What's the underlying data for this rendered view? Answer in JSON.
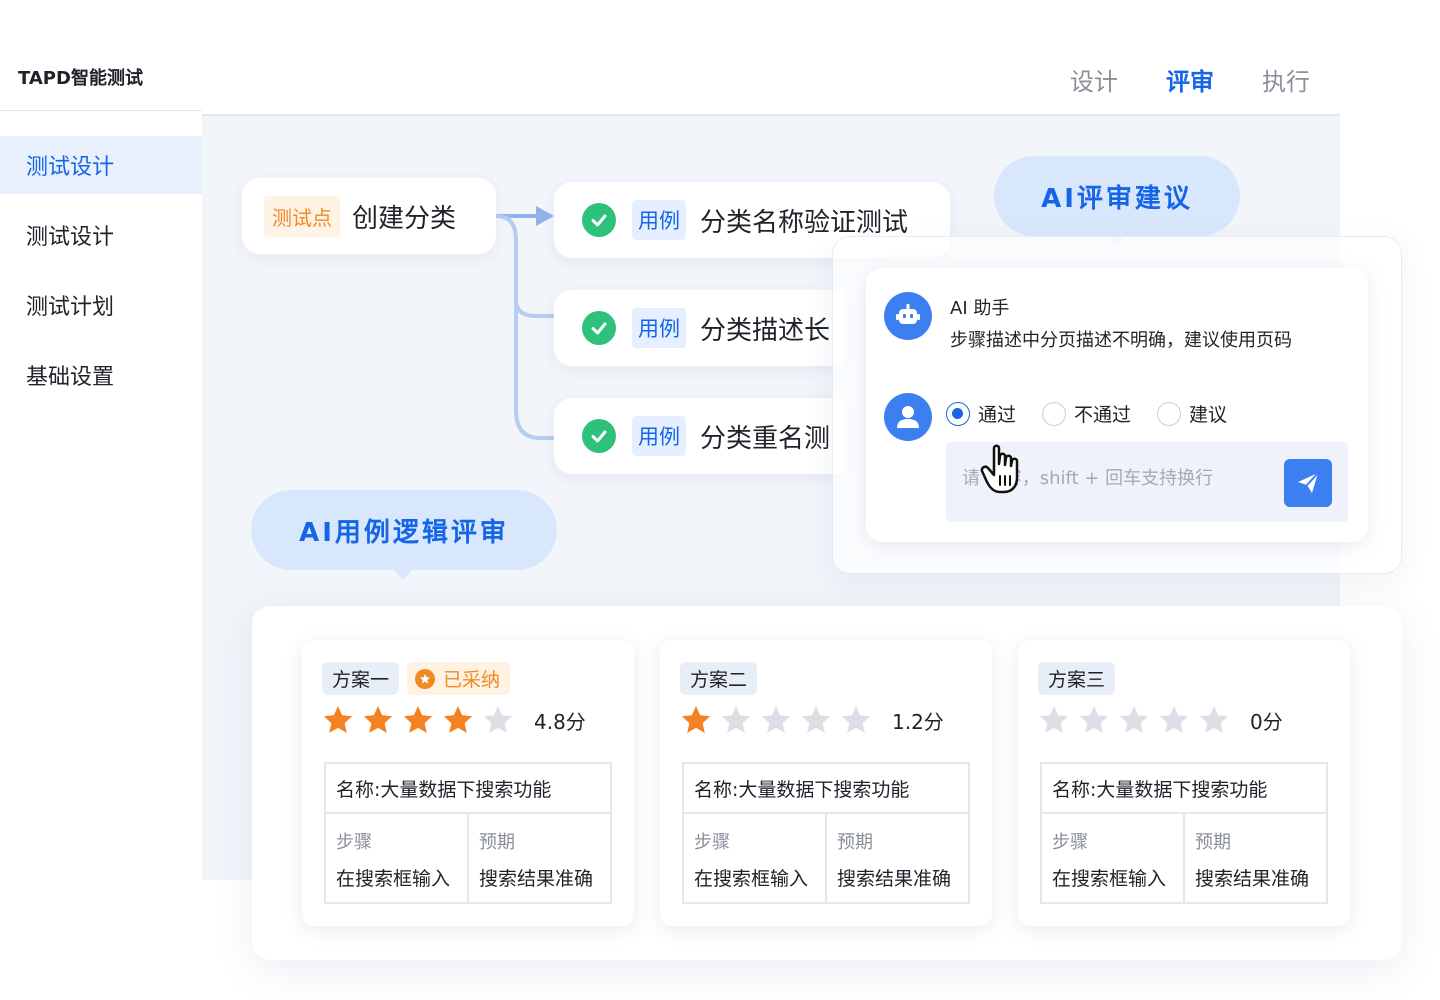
{
  "app": {
    "title": "TAPD智能测试"
  },
  "sidebar": {
    "items": [
      {
        "label": "测试设计",
        "active": true
      },
      {
        "label": "测试设计",
        "active": false
      },
      {
        "label": "测试计划",
        "active": false
      },
      {
        "label": "基础设置",
        "active": false
      }
    ]
  },
  "tabs": [
    {
      "label": "设计",
      "active": false
    },
    {
      "label": "评审",
      "active": true
    },
    {
      "label": "执行",
      "active": false
    }
  ],
  "mindmap": {
    "root": {
      "tag": "测试点",
      "title": "创建分类"
    },
    "cases": [
      {
        "tag": "用例",
        "title": "分类名称验证测试"
      },
      {
        "tag": "用例",
        "title": "分类描述长"
      },
      {
        "tag": "用例",
        "title": "分类重名测"
      }
    ]
  },
  "pills": {
    "review": "AI评审建议",
    "logic": "AI用例逻辑评审"
  },
  "review": {
    "assistant_name": "AI 助手",
    "assistant_message": "步骤描述中分页描述不明确，建议使用页码",
    "options": [
      {
        "label": "通过",
        "checked": true
      },
      {
        "label": "不通过",
        "checked": false
      },
      {
        "label": "建议",
        "checked": false
      }
    ],
    "input_placeholder": "请    内容，shift + 回车支持换行"
  },
  "schemes": [
    {
      "name": "方案一",
      "adopted_label": "已采纳",
      "rating": 4,
      "score": "4.8分",
      "case_name": "名称:大量数据下搜索功能",
      "step_head": "步骤",
      "step_val": "在搜索框输入",
      "expect_head": "预期",
      "expect_val": "搜索结果准确"
    },
    {
      "name": "方案二",
      "adopted_label": "",
      "rating": 1,
      "score": "1.2分",
      "case_name": "名称:大量数据下搜索功能",
      "step_head": "步骤",
      "step_val": "在搜索框输入",
      "expect_head": "预期",
      "expect_val": "搜索结果准确"
    },
    {
      "name": "方案三",
      "adopted_label": "",
      "rating": 0,
      "score": "0分",
      "case_name": "名称:大量数据下搜索功能",
      "step_head": "步骤",
      "step_val": "在搜索框输入",
      "expect_head": "预期",
      "expect_val": "搜索结果准确"
    }
  ],
  "colors": {
    "accent": "#1565e8",
    "success": "#2ec17c",
    "star_on": "#f58220",
    "star_off": "#dcdfe5",
    "orange_tag": "#f08a24"
  }
}
